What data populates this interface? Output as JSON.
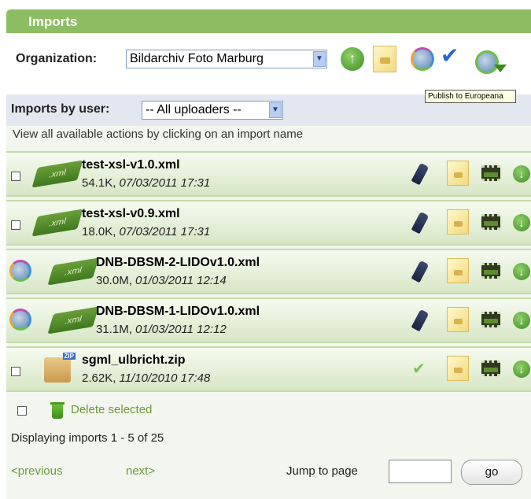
{
  "panel": {
    "title": "Imports"
  },
  "org": {
    "label": "Organization:",
    "selected": "Bildarchiv Foto Marburg",
    "tooltip": "Publish to Europeana",
    "icons": [
      "upload-icon",
      "import-document-icon",
      "globe-icon",
      "checkmark-icon",
      "globe-download-icon"
    ]
  },
  "user_filter": {
    "label": "Imports by user:",
    "selected": "-- All uploaders --"
  },
  "hint": "View all available actions by clicking on an import name",
  "imports": [
    {
      "name": "test-xsl-v1.0.xml",
      "size": "54.1K, ",
      "date": "07/03/2011 17:31",
      "type": "xml",
      "status_icon": "pen-icon"
    },
    {
      "name": "test-xsl-v0.9.xml",
      "size": "18.0K, ",
      "date": "07/03/2011 17:31",
      "type": "xml",
      "status_icon": "pen-icon"
    },
    {
      "name": "DNB-DBSM-2-LIDOv1.0.xml",
      "size": "30.0M, ",
      "date": "01/03/2011 12:14",
      "type": "xml",
      "status_icon": "pen-icon",
      "published": true
    },
    {
      "name": "DNB-DBSM-1-LIDOv1.0.xml",
      "size": "31.1M, ",
      "date": "01/03/2011 12:12",
      "type": "xml",
      "status_icon": "pen-icon",
      "published": true
    },
    {
      "name": "sgml_ulbricht.zip",
      "size": "2.62K, ",
      "date": "11/10/2010 17:48",
      "type": "zip",
      "status_icon": "checkmark-icon"
    }
  ],
  "actions": {
    "delete_label": "Delete selected"
  },
  "pagination": {
    "summary": "Displaying imports 1 - 5 of 25",
    "prev": "<previous",
    "next": "next>",
    "jump_label": "Jump to page",
    "jump_value": "",
    "go": "go"
  },
  "colors": {
    "header": "#8cbd62",
    "row_border": "#c3dbab",
    "link": "#6d9b3a",
    "user_row": "#e3e7ef"
  }
}
